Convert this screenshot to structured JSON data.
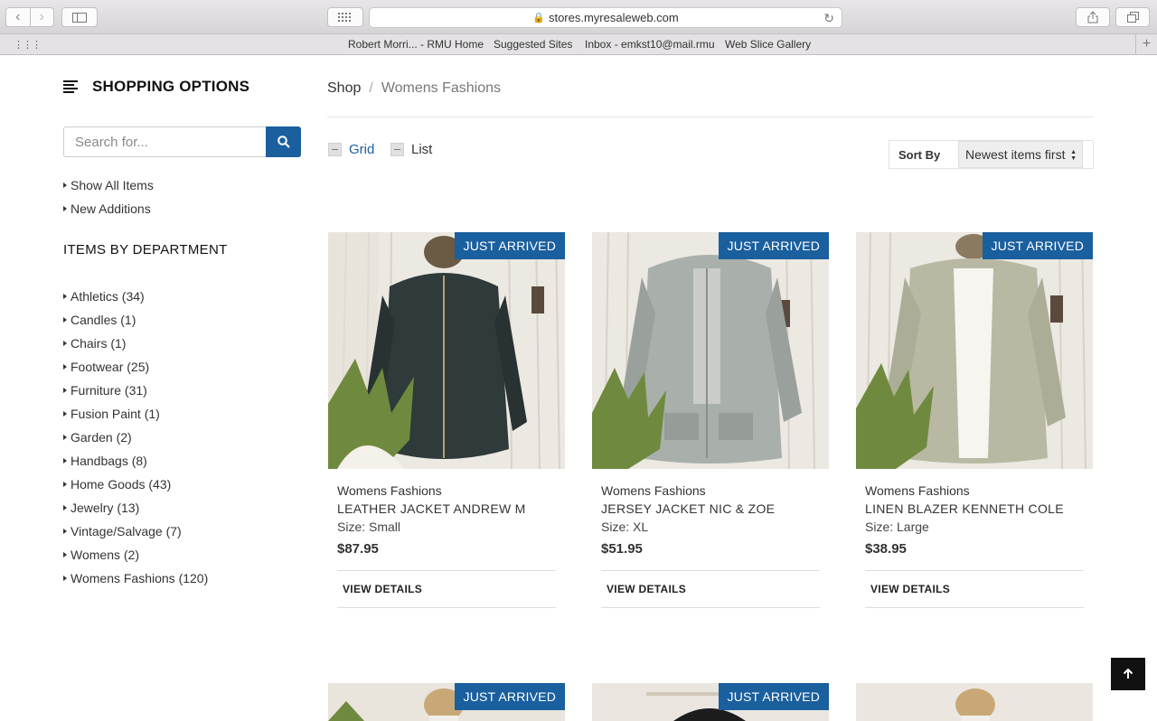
{
  "browser": {
    "url": "stores.myresaleweb.com",
    "favorites": [
      "Robert Morri... - RMU Home",
      "Suggested Sites",
      "Inbox - emkst10@mail.rmu",
      "Web Slice Gallery"
    ]
  },
  "sidebar": {
    "title": "SHOPPING OPTIONS",
    "search_placeholder": "Search for...",
    "links": [
      "Show All Items",
      "New Additions"
    ],
    "dept_heading": "ITEMS BY DEPARTMENT",
    "departments": [
      "Athletics (34)",
      "Candles (1)",
      "Chairs (1)",
      "Footwear (25)",
      "Furniture (31)",
      "Fusion Paint (1)",
      "Garden (2)",
      "Handbags (8)",
      "Home Goods (43)",
      "Jewelry (13)",
      "Vintage/Salvage (7)",
      "Womens (2)",
      "Womens Fashions (120)"
    ]
  },
  "main": {
    "breadcrumb": {
      "root": "Shop",
      "sep": "/",
      "current": "Womens Fashions"
    },
    "view": {
      "grid": "Grid",
      "list": "List"
    },
    "sort": {
      "label": "Sort By",
      "value": "Newest items first"
    },
    "badge": "JUST ARRIVED",
    "products": [
      {
        "category": "Womens Fashions",
        "name": "LEATHER JACKET ANDREW M",
        "size": "Size: Small",
        "price": "$87.95",
        "action": "VIEW DETAILS"
      },
      {
        "category": "Womens Fashions",
        "name": "JERSEY JACKET NIC & ZOE",
        "size": "Size: XL",
        "price": "$51.95",
        "action": "VIEW DETAILS"
      },
      {
        "category": "Womens Fashions",
        "name": "LINEN BLAZER KENNETH COLE",
        "size": "Size: Large",
        "price": "$38.95",
        "action": "VIEW DETAILS"
      }
    ]
  },
  "colors": {
    "accent": "#1a5f9e"
  }
}
